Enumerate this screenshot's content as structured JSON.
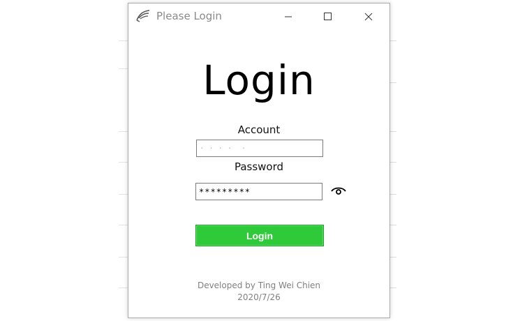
{
  "window": {
    "title": "Please Login",
    "icon": "feather-logo-icon",
    "controls": {
      "minimize": "minimize-icon",
      "maximize": "maximize-icon",
      "close": "close-icon"
    }
  },
  "form": {
    "heading": "Login",
    "account_label": "Account",
    "account_value": "· · · ·  ·",
    "password_label": "Password",
    "password_value": "*********",
    "show_password_icon": "eye-icon",
    "submit_label": "Login",
    "submit_color": "#2fca3a"
  },
  "footer": {
    "credit": "Developed by Ting Wei Chien",
    "date": "2020/7/26"
  }
}
